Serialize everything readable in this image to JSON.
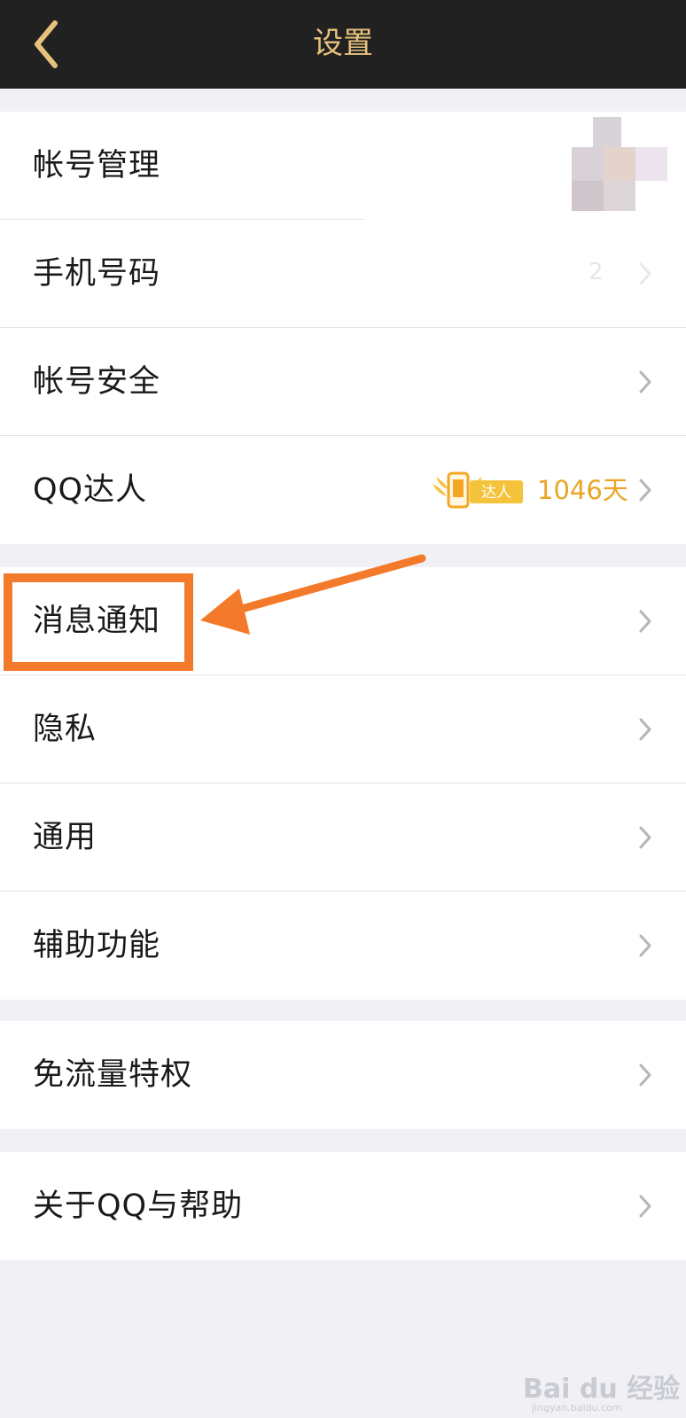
{
  "header": {
    "title": "设置",
    "back_icon": "chevron-left-icon"
  },
  "groups": [
    {
      "items": [
        {
          "label": "帐号管理"
        },
        {
          "label": "手机号码",
          "value": "2"
        },
        {
          "label": "帐号安全"
        },
        {
          "label": "QQ达人",
          "badge_text": "达人",
          "days": "1046天"
        }
      ]
    },
    {
      "items": [
        {
          "label": "消息通知"
        },
        {
          "label": "隐私"
        },
        {
          "label": "通用"
        },
        {
          "label": "辅助功能"
        }
      ]
    },
    {
      "items": [
        {
          "label": "免流量特权"
        }
      ]
    },
    {
      "items": [
        {
          "label": "关于QQ与帮助"
        }
      ]
    }
  ],
  "watermark": {
    "text": "Bai du 经验",
    "sub": "jingyan.baidu.com"
  },
  "colors": {
    "accent": "#e6c27d",
    "highlight": "#f47a2b",
    "badge": "#f5c33b"
  }
}
